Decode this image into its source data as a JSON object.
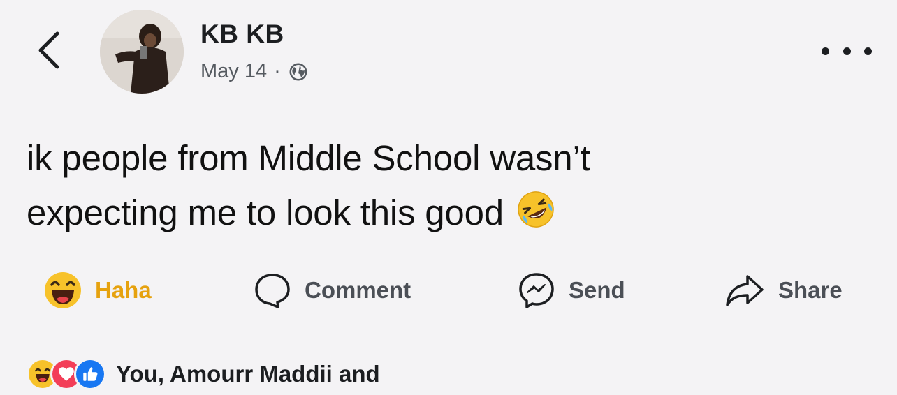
{
  "post": {
    "author": "KB KB",
    "date": "May 14",
    "separator": "·",
    "privacy_icon": "globe-icon",
    "text_line1": "ik people from Middle School wasn’t",
    "text_line2": "expecting me to look this good",
    "emoji": "rolling-on-floor-laughing-emoji"
  },
  "actions": {
    "haha_label": "Haha",
    "comment_label": "Comment",
    "send_label": "Send",
    "share_label": "Share"
  },
  "reactions": {
    "summary": "You, Amourr Maddii and"
  },
  "colors": {
    "background": "#f4f3f5",
    "haha": "#e6a20f",
    "love": "#f33e58",
    "like": "#1877f2"
  }
}
